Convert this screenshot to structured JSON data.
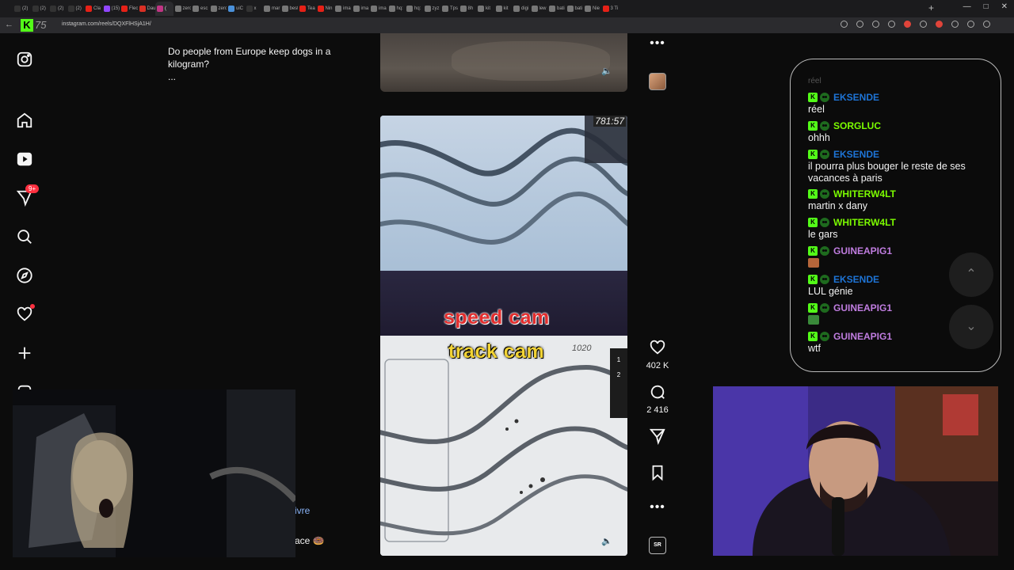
{
  "browser": {
    "tabs": [
      {
        "label": "(2)",
        "icon": "x-icon",
        "color": "#333333"
      },
      {
        "label": "(2)",
        "icon": "x-icon",
        "color": "#333333"
      },
      {
        "label": "(2)",
        "icon": "x-icon",
        "color": "#333333"
      },
      {
        "label": "(2)",
        "icon": "x-icon",
        "color": "#333333"
      },
      {
        "label": "Cla",
        "icon": "youtube-icon",
        "color": "#e62117"
      },
      {
        "label": "(15)",
        "icon": "twitch-icon",
        "color": "#9146ff"
      },
      {
        "label": "Flec",
        "icon": "youtube-icon",
        "color": "#e62117"
      },
      {
        "label": "Dau",
        "icon": "mail-icon",
        "color": "#d93025"
      },
      {
        "label": "(",
        "icon": "instagram-icon",
        "color": "#c13584",
        "active": true
      },
      {
        "label": "zerc",
        "icon": "globe-icon",
        "color": "#777777"
      },
      {
        "label": "esc",
        "icon": "globe-icon",
        "color": "#777777"
      },
      {
        "label": "zerc",
        "icon": "globe-icon",
        "color": "#777777"
      },
      {
        "label": "uiC",
        "icon": "globe-icon",
        "color": "#4a90d9"
      },
      {
        "label": "x",
        "icon": "x-icon",
        "color": "#333333"
      },
      {
        "label": "mar",
        "icon": "globe-icon",
        "color": "#777777"
      },
      {
        "label": "best",
        "icon": "globe-icon",
        "color": "#777777"
      },
      {
        "label": "Tea",
        "icon": "youtube-icon",
        "color": "#e62117"
      },
      {
        "label": "Nin",
        "icon": "youtube-icon",
        "color": "#e62117"
      },
      {
        "label": "ima",
        "icon": "globe-icon",
        "color": "#777777"
      },
      {
        "label": "ima",
        "icon": "globe-icon",
        "color": "#777777"
      },
      {
        "label": "ima",
        "icon": "globe-icon",
        "color": "#777777"
      },
      {
        "label": "hq:",
        "icon": "globe-icon",
        "color": "#777777"
      },
      {
        "label": "hq:",
        "icon": "globe-icon",
        "color": "#777777"
      },
      {
        "label": "zyz",
        "icon": "globe-icon",
        "color": "#777777"
      },
      {
        "label": "Tps",
        "icon": "globe-icon",
        "color": "#777777"
      },
      {
        "label": "8h",
        "icon": "globe-icon",
        "color": "#777777"
      },
      {
        "label": "kit",
        "icon": "globe-icon",
        "color": "#777777"
      },
      {
        "label": "kit",
        "icon": "globe-icon",
        "color": "#777777"
      },
      {
        "label": "digi",
        "icon": "globe-icon",
        "color": "#777777"
      },
      {
        "label": "lew",
        "icon": "globe-icon",
        "color": "#777777"
      },
      {
        "label": "bati",
        "icon": "globe-icon",
        "color": "#777777"
      },
      {
        "label": "bati",
        "icon": "globe-icon",
        "color": "#777777"
      },
      {
        "label": "Nie",
        "icon": "globe-icon",
        "color": "#777777"
      },
      {
        "label": "3 Ti",
        "icon": "youtube-icon",
        "color": "#e62117"
      }
    ],
    "new_tab": "+",
    "window_controls": [
      "—",
      "□",
      "✕"
    ],
    "url": "instagram.com/reels/DQXFlHSjA1H/",
    "kick_logo": {
      "k": "K",
      "num": "75"
    }
  },
  "instagram": {
    "nav_badge": "9+",
    "caption_line1": "Do people from Europe keep dogs in a kilogram?",
    "caption_more": "...",
    "reel": {
      "speed_label": "speed cam",
      "track_label": "track cam",
      "timer": "781:57",
      "counter": "1020",
      "leaderboard": [
        "1",
        "2"
      ]
    },
    "actions": {
      "likes": "402 K",
      "comments": "2 416",
      "more": "•••",
      "audio_label": "SR"
    },
    "fragment_follow": "ivre",
    "fragment_place": "ace 🍩"
  },
  "chat": {
    "faded": "réel",
    "accent_color": "#53fc18",
    "messages": [
      {
        "user": "EKSENDE",
        "color": "#1e74d6",
        "text": "réel"
      },
      {
        "user": "SORGLUC",
        "color": "#7cfc00",
        "text": "ohhh"
      },
      {
        "user": "EKSENDE",
        "color": "#1e74d6",
        "text": "il pourra plus bouger le reste de ses vacances à paris"
      },
      {
        "user": "WHITERW4LT",
        "color": "#7cfc00",
        "text": "martin x dany"
      },
      {
        "user": "WHITERW4LT",
        "color": "#7cfc00",
        "text": "le gars"
      },
      {
        "user": "GUINEAPIG1",
        "color": "#c07de0",
        "text": "",
        "emote": "#b5653a"
      },
      {
        "user": "EKSENDE",
        "color": "#1e74d6",
        "text": "LUL génie"
      },
      {
        "user": "GUINEAPIG1",
        "color": "#c07de0",
        "text": "",
        "emote": "#3a8a3a"
      },
      {
        "user": "GUINEAPIG1",
        "color": "#c07de0",
        "text": "wtf"
      }
    ],
    "scroll_up": "⌃",
    "scroll_down": "⌄"
  }
}
